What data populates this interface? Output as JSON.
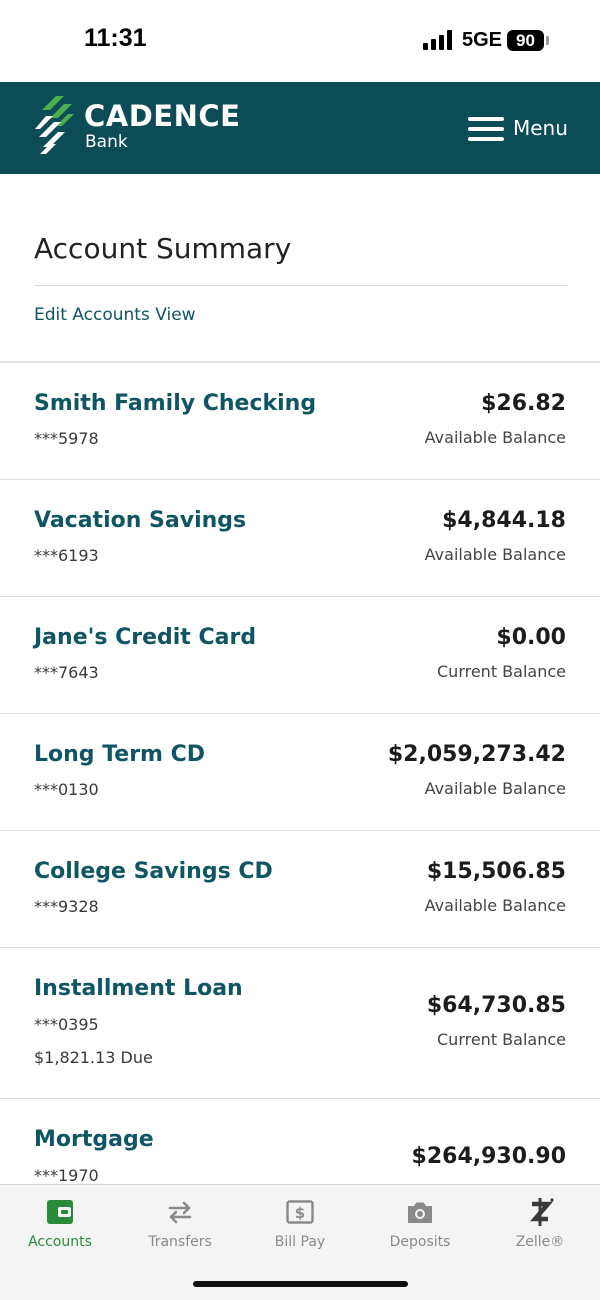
{
  "status_bar": {
    "time": "11:31",
    "network": "5GE",
    "battery": "90"
  },
  "header": {
    "brand_name": "CADENCE",
    "brand_sub": "Bank",
    "menu_label": "Menu",
    "brand_color": "#0c4c57",
    "logo_color": "#4cae4f"
  },
  "summary": {
    "title": "Account Summary",
    "edit_link": "Edit Accounts View"
  },
  "accounts": [
    {
      "name": "Smith Family Checking",
      "number": "***5978",
      "amount": "$26.82",
      "balance_label": "Available Balance"
    },
    {
      "name": "Vacation Savings",
      "number": "***6193",
      "amount": "$4,844.18",
      "balance_label": "Available Balance"
    },
    {
      "name": "Jane's Credit Card",
      "number": "***7643",
      "amount": "$0.00",
      "balance_label": "Current Balance"
    },
    {
      "name": "Long Term CD",
      "number": "***0130",
      "amount": "$2,059,273.42",
      "balance_label": "Available Balance"
    },
    {
      "name": "College Savings CD",
      "number": "***9328",
      "amount": "$15,506.85",
      "balance_label": "Available Balance"
    },
    {
      "name": "Installment Loan",
      "number": "***0395",
      "due": "$1,821.13 Due",
      "amount": "$64,730.85",
      "balance_label": "Current Balance"
    },
    {
      "name": "Mortgage",
      "number": "***1970",
      "amount": "$264,930.90"
    }
  ],
  "tabs": [
    {
      "label": "Accounts",
      "icon": "wallet-icon",
      "active": true
    },
    {
      "label": "Transfers",
      "icon": "transfer-arrows-icon",
      "active": false
    },
    {
      "label": "Bill Pay",
      "icon": "bill-pay-icon",
      "active": false
    },
    {
      "label": "Deposits",
      "icon": "camera-icon",
      "active": false
    },
    {
      "label": "Zelle®",
      "icon": "zelle-icon",
      "active": false
    }
  ],
  "colors": {
    "accent_text": "#0f5563",
    "active_tab": "#2a8a3a",
    "inactive_tab": "#8a8a8a"
  }
}
